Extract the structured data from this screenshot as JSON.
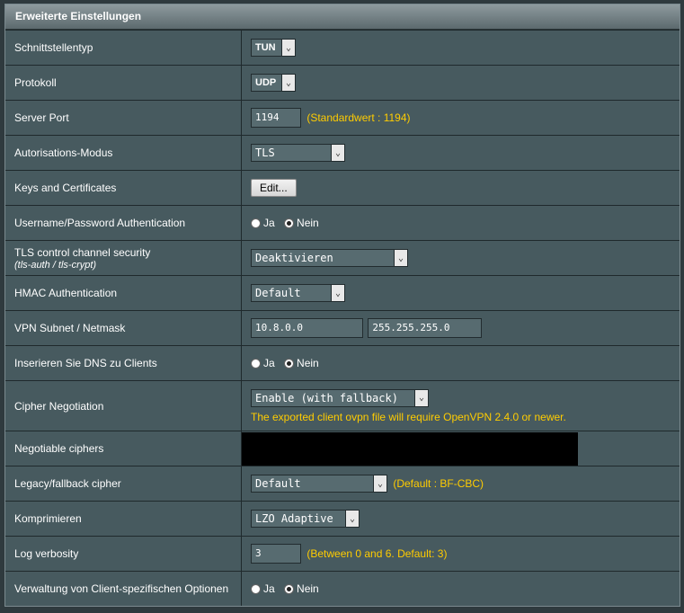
{
  "header": {
    "title": "Erweiterte Einstellungen"
  },
  "rows": {
    "interface_type": {
      "label": "Schnittstellentyp",
      "value": "TUN"
    },
    "protocol": {
      "label": "Protokoll",
      "value": "UDP"
    },
    "server_port": {
      "label": "Server Port",
      "value": "1194",
      "hint": "(Standardwert : 1194)"
    },
    "auth_mode": {
      "label": "Autorisations-Modus",
      "value": "TLS"
    },
    "keys_certs": {
      "label": "Keys and Certificates",
      "button": "Edit..."
    },
    "userpass_auth": {
      "label": "Username/Password Authentication",
      "yes": "Ja",
      "no": "Nein",
      "selected": "Nein"
    },
    "tls_control": {
      "label": "TLS control channel security",
      "sublabel": "(tls-auth / tls-crypt)",
      "value": "Deaktivieren"
    },
    "hmac_auth": {
      "label": "HMAC Authentication",
      "value": "Default"
    },
    "vpn_subnet": {
      "label": "VPN Subnet / Netmask",
      "subnet": "10.8.0.0",
      "netmask": "255.255.255.0"
    },
    "push_dns": {
      "label": "Inserieren Sie DNS zu Clients",
      "yes": "Ja",
      "no": "Nein",
      "selected": "Nein"
    },
    "cipher_negotiation": {
      "label": "Cipher Negotiation",
      "value": "Enable (with fallback)",
      "note": "The exported client ovpn file will require OpenVPN 2.4.0 or newer."
    },
    "negotiable_ciphers": {
      "label": "Negotiable ciphers",
      "value": ""
    },
    "legacy_cipher": {
      "label": "Legacy/fallback cipher",
      "value": "Default",
      "hint": "(Default : BF-CBC)"
    },
    "compression": {
      "label": "Komprimieren",
      "value": "LZO Adaptive"
    },
    "log_verbosity": {
      "label": "Log verbosity",
      "value": "3",
      "hint": "(Between 0 and 6. Default: 3)"
    },
    "client_specific": {
      "label": "Verwaltung von Client-spezifischen Optionen",
      "yes": "Ja",
      "no": "Nein",
      "selected": "Nein"
    }
  }
}
